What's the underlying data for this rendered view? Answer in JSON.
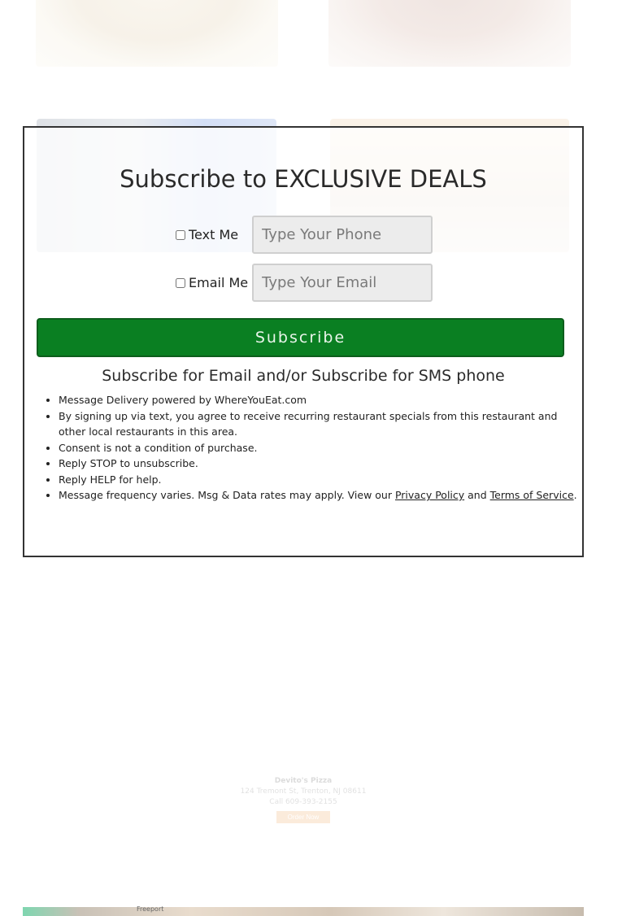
{
  "subscribe": {
    "title": "Subscribe to EXCLUSIVE DEALS",
    "phone_checkbox_label": "Text Me",
    "phone_placeholder": "Type Your Phone",
    "email_checkbox_label": "Email Me",
    "email_placeholder": "Type Your Email",
    "button_label": "Subscribe",
    "subtitle": "Subscribe for Email and/or Subscribe for SMS phone",
    "terms": [
      "Message Delivery powered by WhereYouEat.com",
      "By signing up via text, you agree to receive recurring restaurant specials from this restaurant and other local restaurants in this area.",
      "Consent is not a condition of purchase.",
      "Reply STOP to unsubscribe.",
      "Reply HELP for help."
    ],
    "last_term_prefix": "Message frequency varies. Msg & Data rates may apply. View our ",
    "privacy_link": "Privacy Policy",
    "and_text": " and ",
    "terms_link": "Terms of Service",
    "last_term_suffix": ".",
    "button_color": "#0a7f22"
  },
  "footer": {
    "name": "Devito's Pizza",
    "address": "124 Tremont St, Trenton, NJ 08611",
    "phone": "Call 609-393-2155",
    "order_label": "Order Now"
  },
  "map": {
    "label": "Freeport"
  }
}
